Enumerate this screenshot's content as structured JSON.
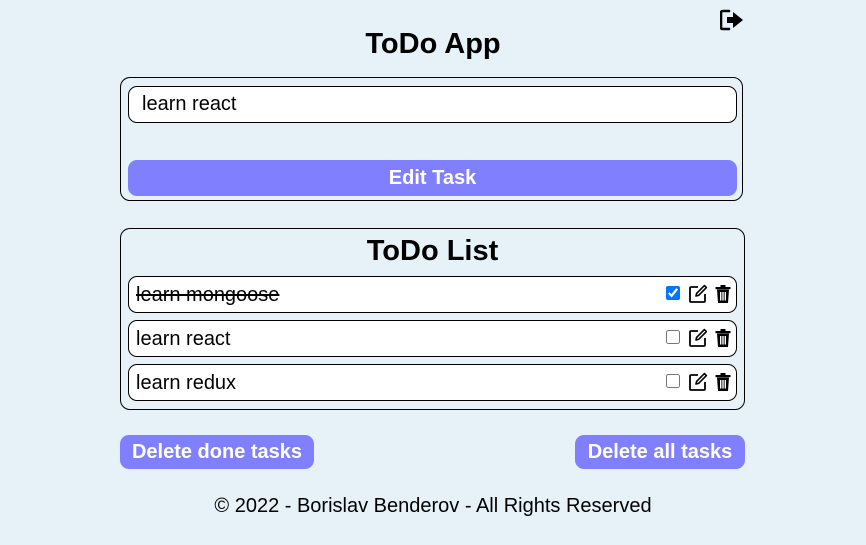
{
  "header": {
    "title": "ToDo App",
    "logout_icon": "sign-out-icon"
  },
  "form": {
    "input_value": "learn react",
    "submit_label": "Edit Task",
    "button_color": "#8080ff"
  },
  "list": {
    "title": "ToDo List",
    "tasks": [
      {
        "text": "learn mongoose",
        "done": true
      },
      {
        "text": "learn react",
        "done": false
      },
      {
        "text": "learn redux",
        "done": false
      }
    ],
    "icons": [
      "edit-icon",
      "trash-icon"
    ]
  },
  "actions": {
    "delete_done_label": "Delete done tasks",
    "delete_all_label": "Delete all tasks"
  },
  "footer": {
    "text": "© 2022 - Borislav Benderov - All Rights Reserved"
  },
  "colors": {
    "background": "#e6f2f8",
    "accent": "#8080ff"
  }
}
